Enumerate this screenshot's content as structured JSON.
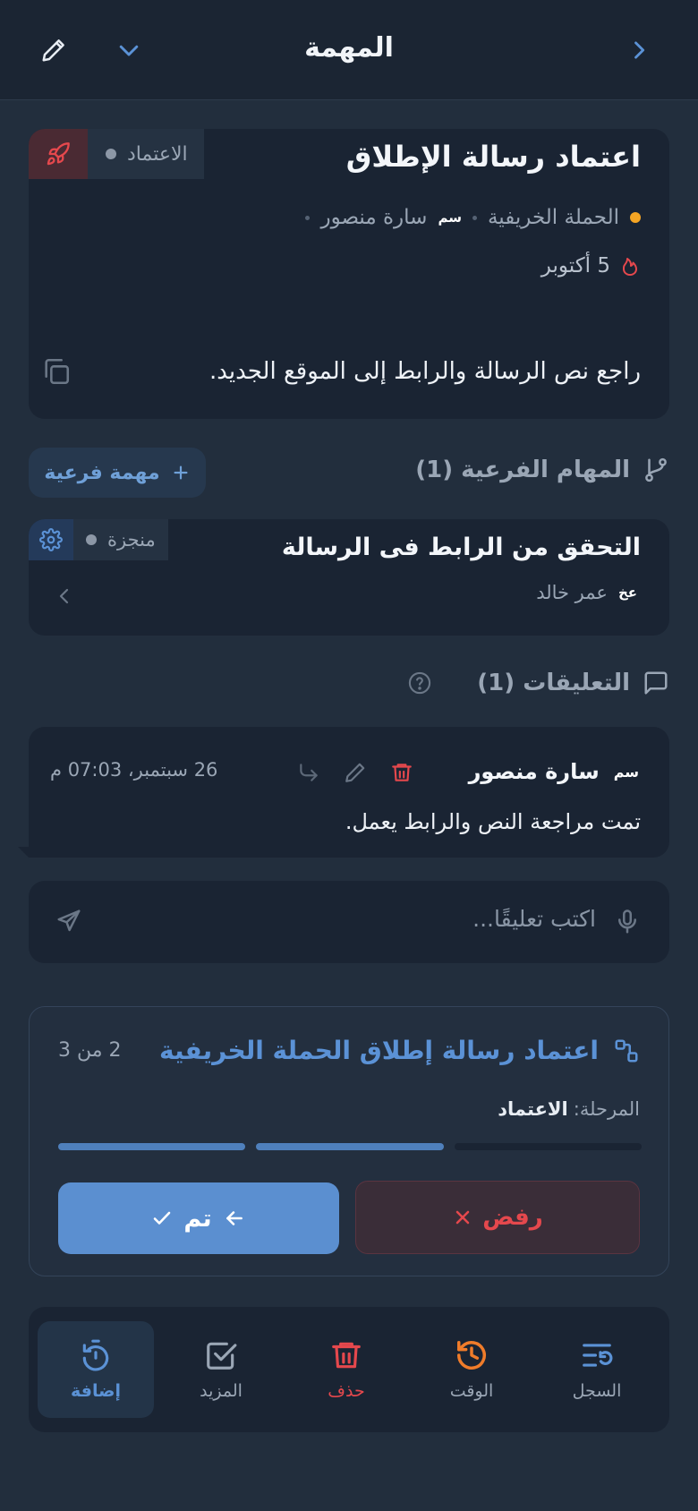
{
  "header": {
    "title": "المهمة"
  },
  "task": {
    "title": "اعتماد رسالة الإطلاق",
    "status": "الاعتماد",
    "project": "الحملة الخريفية",
    "assignee_initials": "سم",
    "assignee_name": "سارة منصور",
    "due": "5 أكتوبر",
    "description": "راجع نص الرسالة والرابط إلى الموقع الجديد."
  },
  "subtasks": {
    "heading": "المهام الفرعية (1)",
    "add_label": "مهمة فرعية",
    "items": [
      {
        "title": "التحقق من الرابط فى الرسالة",
        "status": "منجزة",
        "assignee_initials": "عخ",
        "assignee_name": "عمر خالد"
      }
    ]
  },
  "comments": {
    "heading": "التعليقات (1)",
    "items": [
      {
        "author_initials": "سم",
        "author": "سارة منصور",
        "timestamp": "26 سبتمبر، 07:03 م",
        "text": "تمت مراجعة النص والرابط يعمل."
      }
    ],
    "input_placeholder": "اكتب تعليقًا..."
  },
  "workflow": {
    "title": "اعتماد رسالة إطلاق الحملة الخريفية",
    "step_counter": "2 من 3",
    "stage_label": "المرحلة:",
    "stage_value": "الاعتماد",
    "progress_done": 2,
    "progress_total": 3,
    "reject_label": "رفض",
    "done_label": "تم"
  },
  "bottom_nav": {
    "items": [
      {
        "label": "السجل",
        "icon": "history-list-icon"
      },
      {
        "label": "الوقت",
        "icon": "clock-history-icon"
      },
      {
        "label": "حذف",
        "icon": "trash-icon"
      },
      {
        "label": "المزيد",
        "icon": "checkbox-icon"
      },
      {
        "label": "إضافة",
        "icon": "timer-add-icon"
      }
    ]
  },
  "colors": {
    "accent": "#5b92d6",
    "danger": "#e5484d",
    "orange": "#f5a524",
    "clock": "#f07c2a"
  }
}
